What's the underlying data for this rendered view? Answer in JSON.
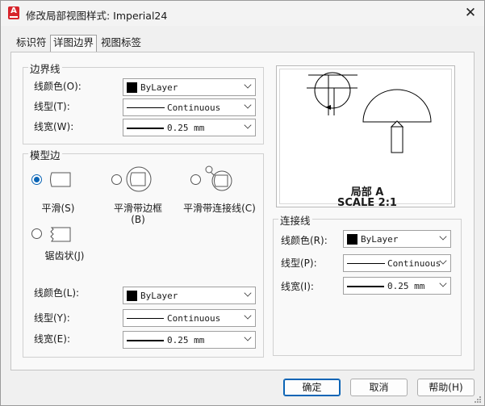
{
  "window": {
    "title": "修改局部视图样式: Imperial24",
    "app_icon_letter": "A"
  },
  "tabs": [
    {
      "label": "标识符",
      "active": false
    },
    {
      "label": "详图边界",
      "active": true
    },
    {
      "label": "视图标签",
      "active": false
    }
  ],
  "boundary": {
    "title": "边界线",
    "color_label": "线颜色(O):",
    "color_value": "ByLayer",
    "linetype_label": "线型(T):",
    "linetype_value": "Continuous",
    "lineweight_label": "线宽(W):",
    "lineweight_value": "0.25 mm"
  },
  "model_edge": {
    "title": "模型边",
    "options": [
      {
        "label": "平滑(S)",
        "selected": true
      },
      {
        "label": "平滑带边框(B)",
        "selected": false
      },
      {
        "label": "平滑带连接线(C)",
        "selected": false
      },
      {
        "label": "锯齿状(J)",
        "selected": false
      }
    ],
    "color_label": "线颜色(L):",
    "color_value": "ByLayer",
    "linetype_label": "线型(Y):",
    "linetype_value": "Continuous",
    "lineweight_label": "线宽(E):",
    "lineweight_value": "0.25 mm"
  },
  "preview": {
    "label_line1": "局部 A",
    "label_line2": "SCALE 2:1"
  },
  "connector": {
    "title": "连接线",
    "color_label": "线颜色(R):",
    "color_value": "ByLayer",
    "linetype_label": "线型(P):",
    "linetype_value": "Continuous",
    "lineweight_label": "线宽(I):",
    "lineweight_value": "0.25 mm"
  },
  "buttons": {
    "ok": "确定",
    "cancel": "取消",
    "help": "帮助(H)"
  }
}
